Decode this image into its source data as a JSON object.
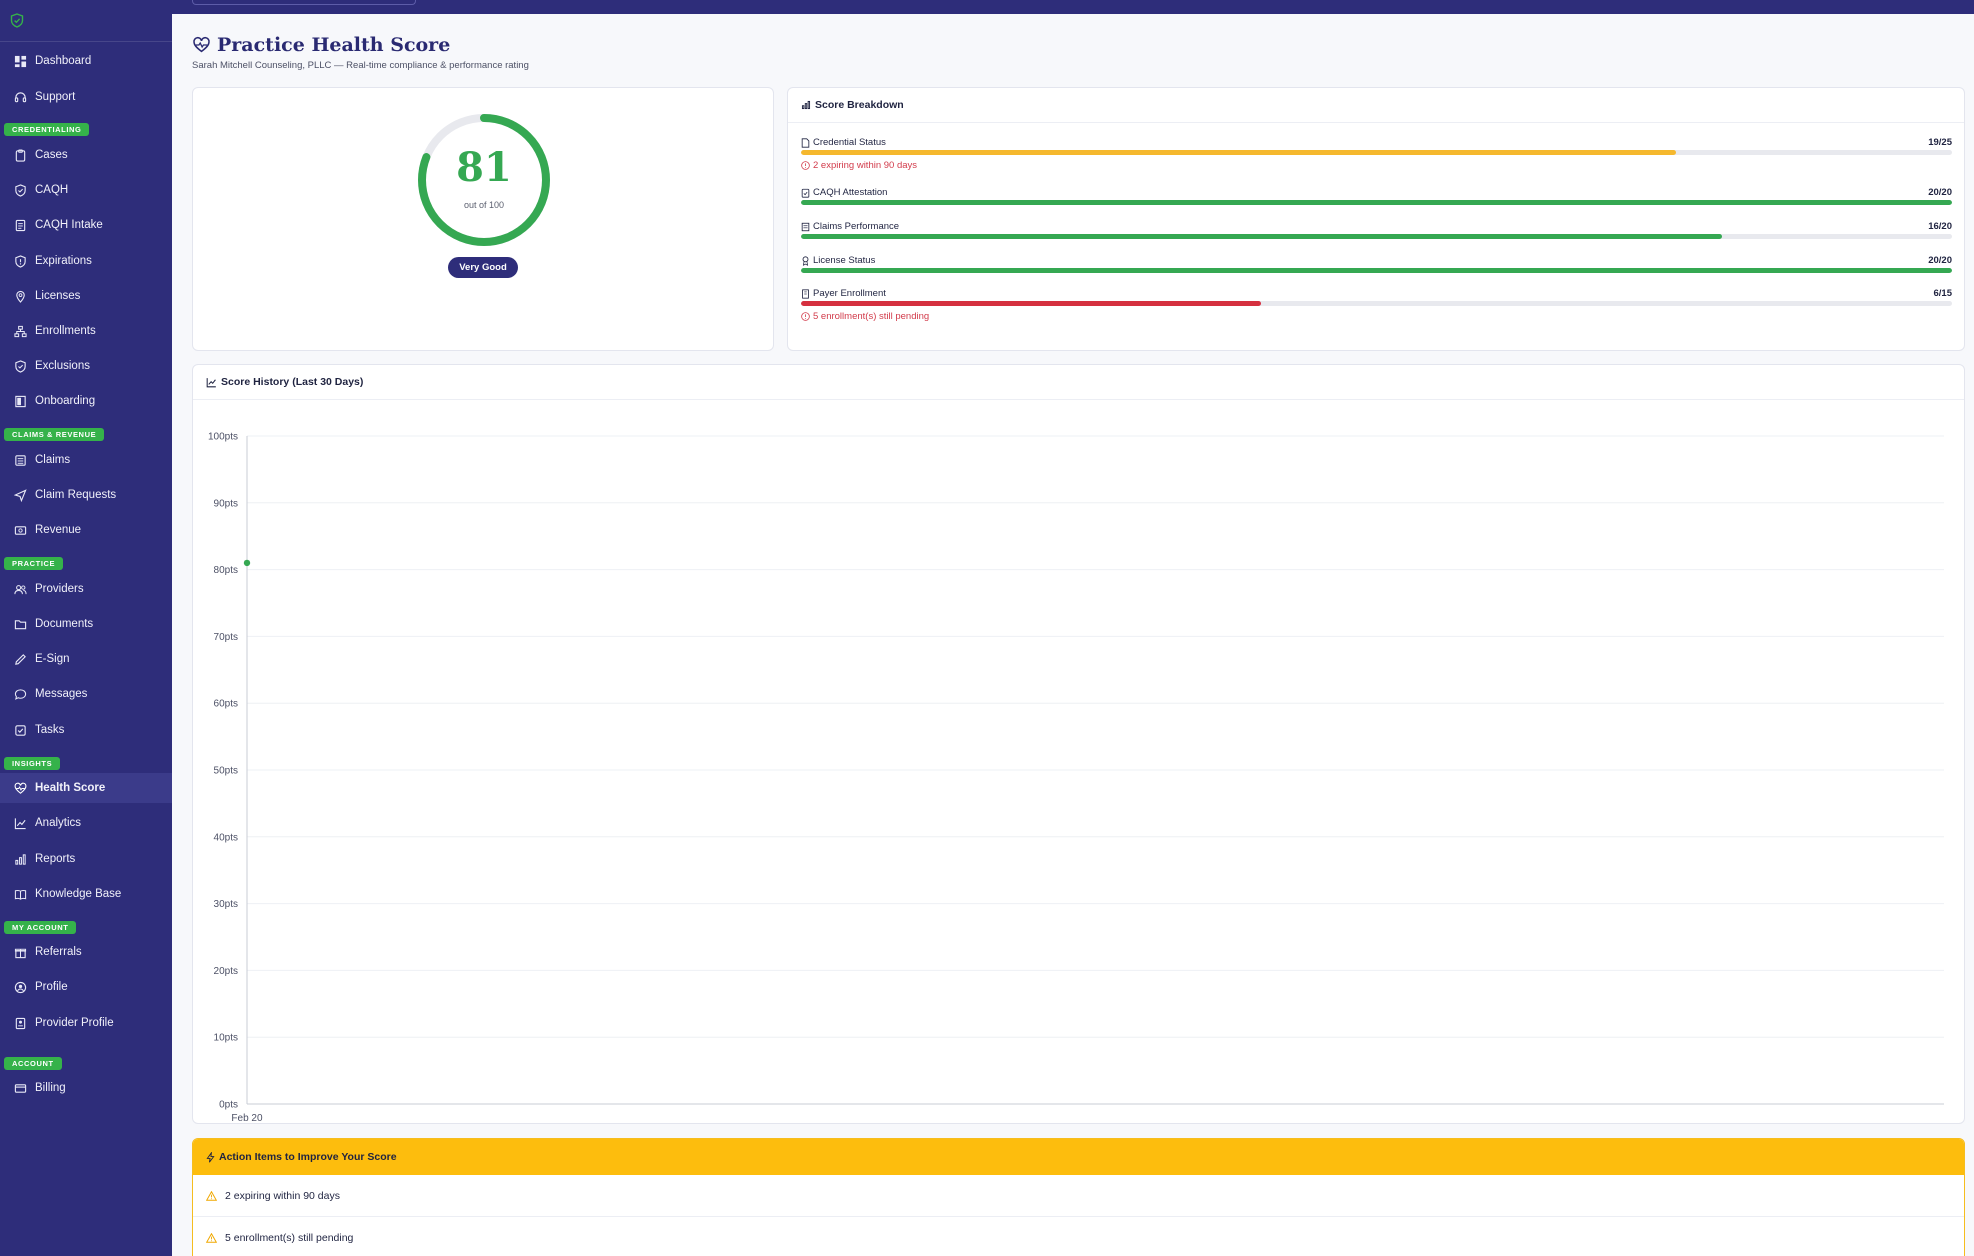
{
  "app": {
    "logo_icon": "shield-check-icon"
  },
  "sidebar": {
    "items": [
      {
        "label": "Dashboard",
        "icon": "grid-icon"
      },
      {
        "label": "Support",
        "icon": "headset-icon"
      },
      {
        "label": "Cases",
        "icon": "clipboard-icon"
      },
      {
        "label": "CAQH",
        "icon": "shield-icon"
      },
      {
        "label": "CAQH Intake",
        "icon": "form-icon"
      },
      {
        "label": "Expirations",
        "icon": "shield-alert-icon"
      },
      {
        "label": "Licenses",
        "icon": "map-pin-icon"
      },
      {
        "label": "Enrollments",
        "icon": "org-chart-icon"
      },
      {
        "label": "Exclusions",
        "icon": "shield-check-icon"
      },
      {
        "label": "Onboarding",
        "icon": "door-icon"
      },
      {
        "label": "Claims",
        "icon": "list-icon"
      },
      {
        "label": "Claim Requests",
        "icon": "send-icon"
      },
      {
        "label": "Revenue",
        "icon": "dollar-icon"
      },
      {
        "label": "Providers",
        "icon": "users-icon"
      },
      {
        "label": "Documents",
        "icon": "folder-icon"
      },
      {
        "label": "E-Sign",
        "icon": "pen-icon"
      },
      {
        "label": "Messages",
        "icon": "chat-icon"
      },
      {
        "label": "Tasks",
        "icon": "checkbox-icon"
      },
      {
        "label": "Health Score",
        "icon": "heart-pulse-icon"
      },
      {
        "label": "Analytics",
        "icon": "line-chart-icon"
      },
      {
        "label": "Reports",
        "icon": "bar-chart-icon"
      },
      {
        "label": "Knowledge Base",
        "icon": "book-icon"
      },
      {
        "label": "Referrals",
        "icon": "gift-icon"
      },
      {
        "label": "Profile",
        "icon": "user-circle-icon"
      },
      {
        "label": "Provider Profile",
        "icon": "id-card-icon"
      },
      {
        "label": "Billing",
        "icon": "credit-card-icon"
      }
    ],
    "active": "Health Score",
    "sections": {
      "credentialing": "CREDENTIALING",
      "claims_revenue": "CLAIMS & REVENUE",
      "practice": "PRACTICE",
      "insights": "INSIGHTS",
      "my_account": "MY ACCOUNT",
      "account": "ACCOUNT"
    }
  },
  "header": {
    "title": "Practice Health Score",
    "subtitle": "Sarah Mitchell Counseling, PLLC — Real-time compliance & performance rating"
  },
  "score": {
    "value": "81",
    "value_fraction": 0.81,
    "out_of": "out of 100",
    "rating": "Very Good"
  },
  "breakdown": {
    "title": "Score Breakdown",
    "items": [
      {
        "label": "Credential Status",
        "score": "19/25",
        "fraction": 0.76,
        "color": "#f5b82e",
        "warning": "2 expiring within 90 days"
      },
      {
        "label": "CAQH Attestation",
        "score": "20/20",
        "fraction": 1.0,
        "color": "#35a852",
        "warning": ""
      },
      {
        "label": "Claims Performance",
        "score": "16/20",
        "fraction": 0.8,
        "color": "#35a852",
        "warning": ""
      },
      {
        "label": "License Status",
        "score": "20/20",
        "fraction": 1.0,
        "color": "#35a852",
        "warning": ""
      },
      {
        "label": "Payer Enrollment",
        "score": "6/15",
        "fraction": 0.4,
        "color": "#d5303f",
        "warning": "5 enrollment(s) still pending"
      }
    ]
  },
  "history": {
    "title": "Score History (Last 30 Days)"
  },
  "chart_data": {
    "type": "line",
    "title": "Score History (Last 30 Days)",
    "x": [
      "Feb 20"
    ],
    "series": [
      {
        "values": [
          81
        ]
      }
    ],
    "ylim": [
      0,
      100
    ],
    "yticks": [
      "0pts",
      "10pts",
      "20pts",
      "30pts",
      "40pts",
      "50pts",
      "60pts",
      "70pts",
      "80pts",
      "90pts",
      "100pts"
    ],
    "grid": true,
    "color": "#35a852"
  },
  "actions": {
    "title": "Action Items to Improve Your Score",
    "items": [
      "2 expiring within 90 days",
      "5 enrollment(s) still pending"
    ]
  }
}
